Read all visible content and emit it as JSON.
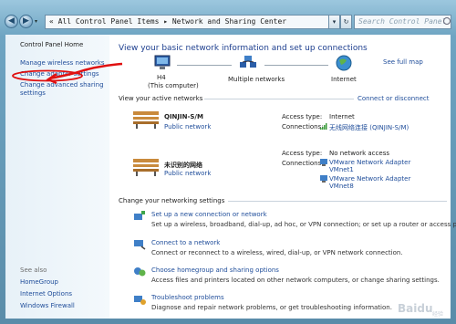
{
  "window": {
    "address": "« All Control Panel Items ▸ Network and Sharing Center",
    "search_placeholder": "Search Control Panel",
    "nav_back": "◀",
    "nav_forward": "▶",
    "address_dropdown": "▾",
    "refresh": "↻",
    "recent_arrow": "▾"
  },
  "sidebar": {
    "home": "Control Panel Home",
    "items": [
      "Manage wireless networks",
      "Change adapter settings",
      "Change advanced sharing settings"
    ],
    "see_also_label": "See also",
    "see_also": [
      "HomeGroup",
      "Internet Options",
      "Windows Firewall"
    ]
  },
  "main": {
    "title": "View your basic network information and set up connections",
    "see_full_map": "See full map",
    "map": {
      "computer_name": "H4",
      "computer_sub": "(This computer)",
      "middle": "Multiple networks",
      "internet": "Internet"
    },
    "active_label": "View your active networks",
    "connect_disconnect": "Connect or disconnect",
    "networks": [
      {
        "name": "QINJIN-S/M",
        "type": "Public network",
        "access_label": "Access type:",
        "access_value": "Internet",
        "conn_label": "Connections:",
        "connections": [
          "无线网络连接 (QINJIN-S/M)"
        ]
      },
      {
        "name": "未识别的网络",
        "type": "Public network",
        "access_label": "Access type:",
        "access_value": "No network access",
        "conn_label": "Connections:",
        "connections": [
          "VMware Network Adapter VMnet1",
          "VMware Network Adapter VMnet8"
        ]
      }
    ],
    "settings_label": "Change your networking settings",
    "tasks": [
      {
        "title": "Set up a new connection or network",
        "desc": "Set up a wireless, broadband, dial-up, ad hoc, or VPN connection; or set up a router or access point."
      },
      {
        "title": "Connect to a network",
        "desc": "Connect or reconnect to a wireless, wired, dial-up, or VPN network connection."
      },
      {
        "title": "Choose homegroup and sharing options",
        "desc": "Access files and printers located on other network computers, or change sharing settings."
      },
      {
        "title": "Troubleshoot problems",
        "desc": "Diagnose and repair network problems, or get troubleshooting information."
      }
    ]
  },
  "watermark": "Baidu 经验"
}
